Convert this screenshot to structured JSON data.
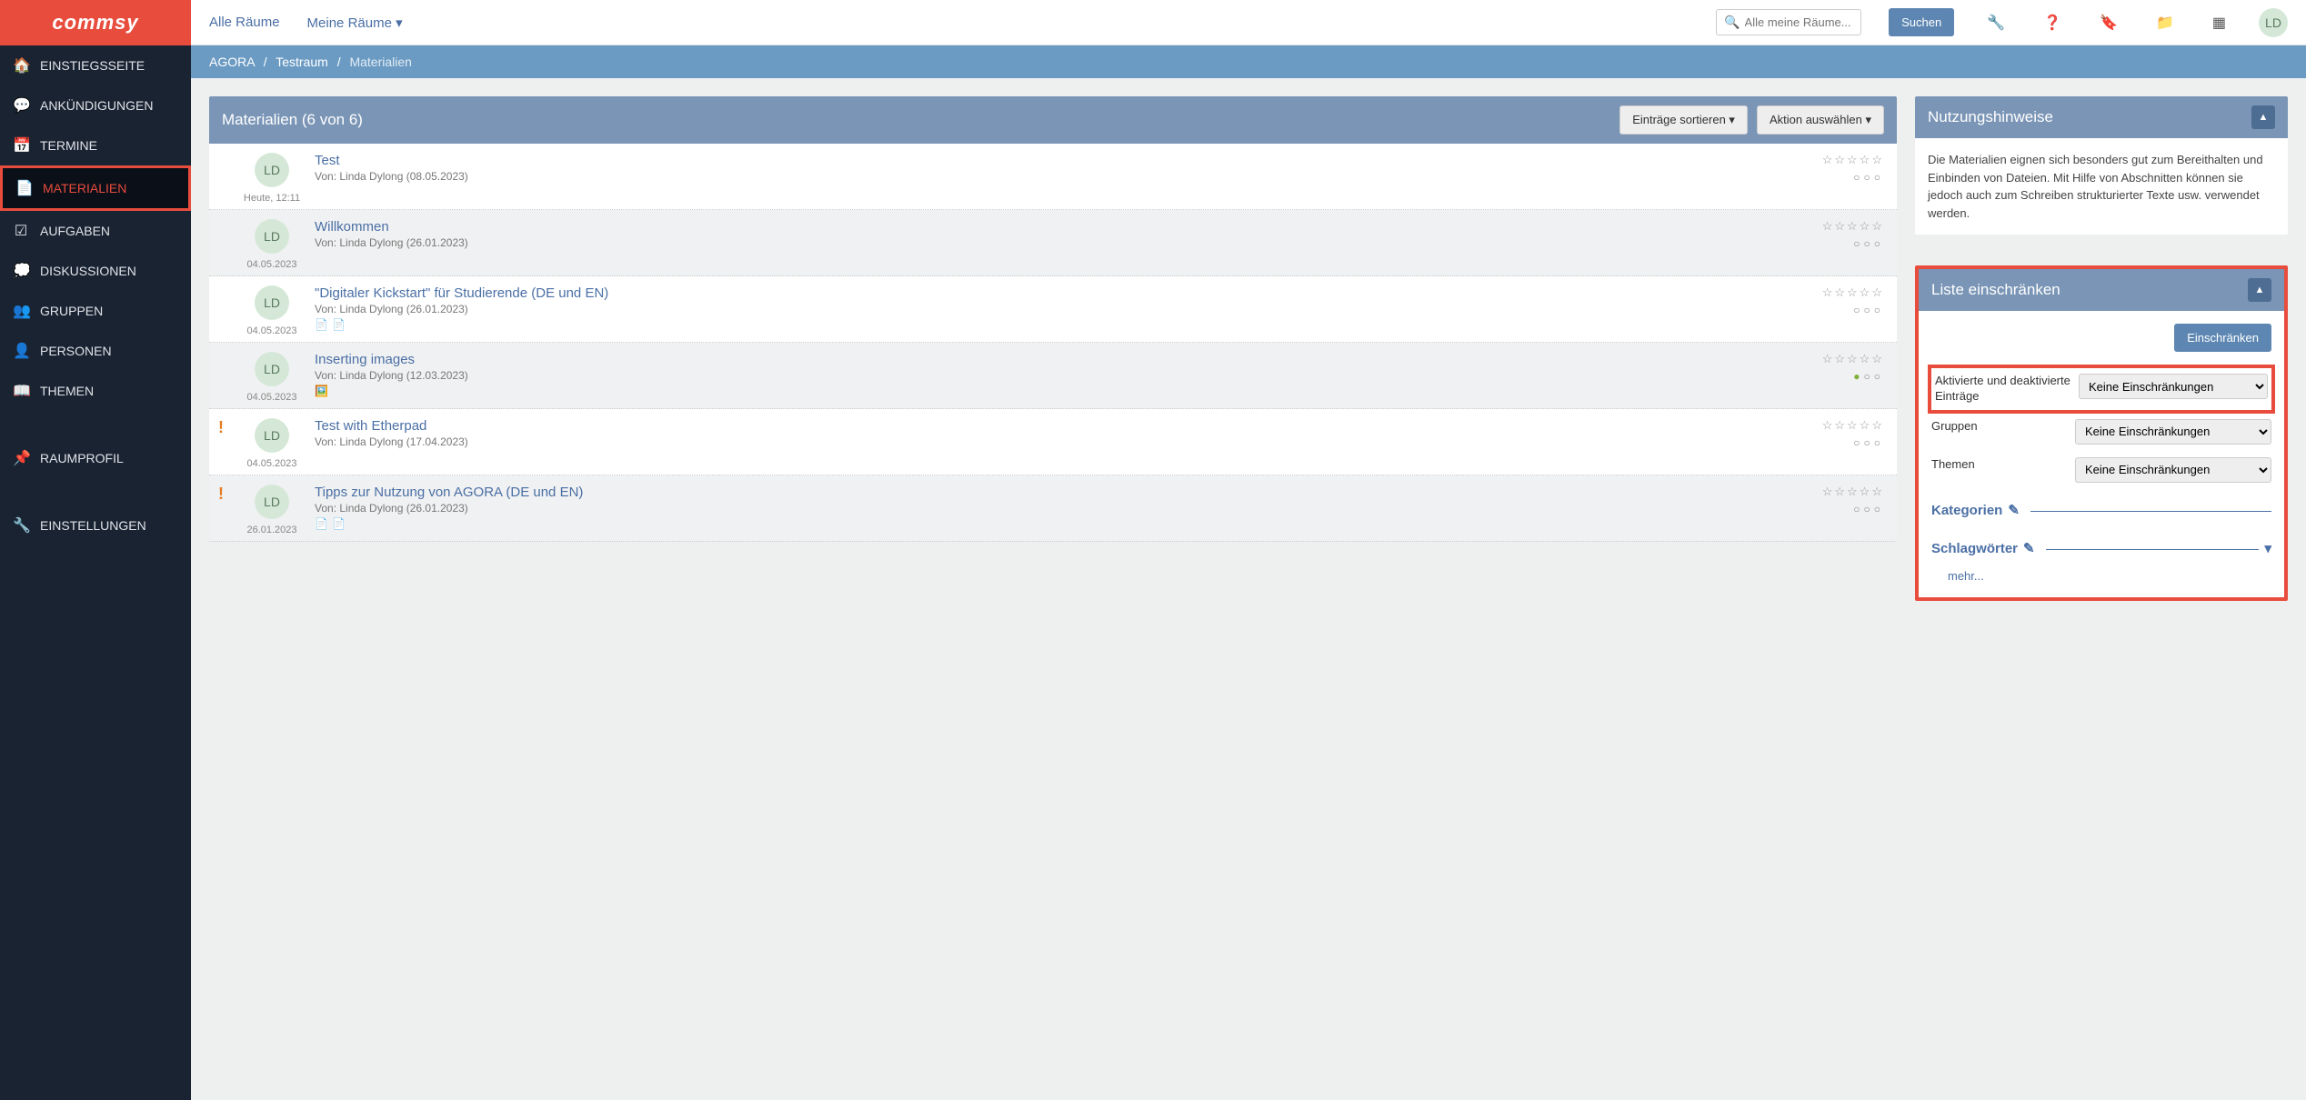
{
  "logo": "commsy",
  "topbar": {
    "all_rooms": "Alle Räume",
    "my_rooms": "Meine Räume",
    "search_placeholder": "Alle meine Räume...",
    "search_btn": "Suchen",
    "avatar": "LD"
  },
  "sidebar": {
    "items": [
      {
        "icon": "home",
        "label": "EINSTIEGSSEITE"
      },
      {
        "icon": "bubble",
        "label": "ANKÜNDIGUNGEN"
      },
      {
        "icon": "calendar",
        "label": "TERMINE"
      },
      {
        "icon": "doc",
        "label": "MATERIALIEN",
        "active": true
      },
      {
        "icon": "check",
        "label": "AUFGABEN"
      },
      {
        "icon": "chat",
        "label": "DISKUSSIONEN"
      },
      {
        "icon": "group",
        "label": "GRUPPEN"
      },
      {
        "icon": "user",
        "label": "PERSONEN"
      },
      {
        "icon": "book",
        "label": "THEMEN"
      }
    ],
    "lower": [
      {
        "icon": "pin",
        "label": "RAUMPROFIL"
      },
      {
        "icon": "wrench",
        "label": "EINSTELLUNGEN"
      }
    ]
  },
  "breadcrumb": {
    "a": "AGORA",
    "b": "Testraum",
    "c": "Materialien"
  },
  "list": {
    "title": "Materialien (6 von 6)",
    "sort_btn": "Einträge sortieren",
    "action_btn": "Aktion auswählen",
    "items": [
      {
        "avatar": "LD",
        "date": "Heute, 12:11",
        "title": "Test",
        "meta": "Von: Linda Dylong (08.05.2023)",
        "stars": "☆☆☆☆☆",
        "circles": "○○○",
        "attach": []
      },
      {
        "avatar": "LD",
        "date": "04.05.2023",
        "title": "Willkommen",
        "meta": "Von: Linda Dylong (26.01.2023)",
        "stars": "☆☆☆☆☆",
        "circles": "○○○",
        "attach": [],
        "alt": true
      },
      {
        "avatar": "LD",
        "date": "04.05.2023",
        "title": "\"Digitaler Kickstart\" für Studierende (DE und EN)",
        "meta": "Von: Linda Dylong (26.01.2023)",
        "stars": "☆☆☆☆☆",
        "circles": "○○○",
        "attach": [
          "pdf",
          "pdf"
        ]
      },
      {
        "avatar": "LD",
        "date": "04.05.2023",
        "title": "Inserting images",
        "meta": "Von: Linda Dylong (12.03.2023)",
        "stars": "☆☆☆☆☆",
        "circles_html": "<span class=\"filled\">●</span>○○",
        "attach": [
          "img"
        ],
        "alt": true
      },
      {
        "avatar": "LD",
        "date": "04.05.2023",
        "title": "Test with Etherpad",
        "meta": "Von: Linda Dylong (17.04.2023)",
        "stars": "☆☆☆☆☆",
        "circles": "○○○",
        "attach": [],
        "exclaim": true
      },
      {
        "avatar": "LD",
        "date": "26.01.2023",
        "title": "Tipps zur Nutzung von AGORA (DE und EN)",
        "meta": "Von: Linda Dylong (26.01.2023)",
        "stars": "☆☆☆☆☆",
        "circles": "○○○",
        "attach": [
          "pdf",
          "pdf"
        ],
        "exclaim": true,
        "alt": true
      }
    ]
  },
  "hints": {
    "title": "Nutzungshinweise",
    "body": "Die Materialien eignen sich besonders gut zum Bereithalten und Einbinden von Dateien. Mit Hilfe von Abschnitten können sie jedoch auch zum Schreiben strukturierter Texte usw. verwendet werden."
  },
  "filter": {
    "title": "Liste einschränken",
    "submit": "Einschränken",
    "rows": {
      "activated_label": "Aktivierte und deaktivierte Einträge",
      "activated_value": "Keine Einschränkungen",
      "groups_label": "Gruppen",
      "groups_value": "Keine Einschränkungen",
      "themes_label": "Themen",
      "themes_value": "Keine Einschränkungen"
    },
    "categories": "Kategorien",
    "tags": "Schlagwörter",
    "more": "mehr..."
  }
}
